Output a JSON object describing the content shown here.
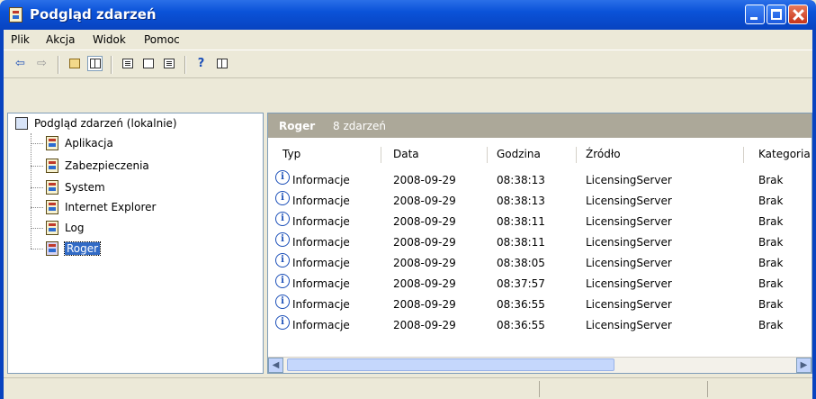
{
  "window": {
    "title": "Podgląd zdarzeń"
  },
  "menu": {
    "items": [
      "Plik",
      "Akcja",
      "Widok",
      "Pomoc"
    ]
  },
  "toolbar": {
    "buttons": [
      "back-arrow-icon",
      "forward-arrow-icon",
      "up-folder-icon",
      "show-hide-tree-icon",
      "properties-icon",
      "refresh-icon",
      "export-list-icon",
      "help-icon",
      "show-hide-action-pane-icon"
    ]
  },
  "tree": {
    "root": "Podgląd zdarzeń (lokalnie)",
    "items": [
      "Aplikacja",
      "Zabezpieczenia",
      "System",
      "Internet Explorer",
      "Log",
      "Roger"
    ],
    "selected": "Roger"
  },
  "list": {
    "name": "Roger",
    "count": "8 zdarzeń",
    "columns": [
      "Typ",
      "Data",
      "Godzina",
      "Źródło",
      "Kategoria"
    ],
    "rows": [
      [
        "Informacje",
        "2008-09-29",
        "08:38:13",
        "LicensingServer",
        "Brak"
      ],
      [
        "Informacje",
        "2008-09-29",
        "08:38:13",
        "LicensingServer",
        "Brak"
      ],
      [
        "Informacje",
        "2008-09-29",
        "08:38:11",
        "LicensingServer",
        "Brak"
      ],
      [
        "Informacje",
        "2008-09-29",
        "08:38:11",
        "LicensingServer",
        "Brak"
      ],
      [
        "Informacje",
        "2008-09-29",
        "08:38:05",
        "LicensingServer",
        "Brak"
      ],
      [
        "Informacje",
        "2008-09-29",
        "08:37:57",
        "LicensingServer",
        "Brak"
      ],
      [
        "Informacje",
        "2008-09-29",
        "08:36:55",
        "LicensingServer",
        "Brak"
      ],
      [
        "Informacje",
        "2008-09-29",
        "08:36:55",
        "LicensingServer",
        "Brak"
      ]
    ]
  }
}
